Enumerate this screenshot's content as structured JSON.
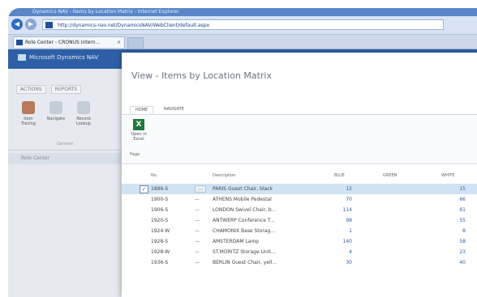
{
  "browser": {
    "title": "Dynamics NAV - Items by Location Matrix - Internet Explorer",
    "url": "http://dynamics-nav.net/DynamicsNAV/WebClient/default.aspx",
    "tab_label": "Role Center - CRONUS Intern...",
    "tab_close": "×",
    "back_glyph": "◀",
    "forward_glyph": "▶"
  },
  "app": {
    "brand": "Microsoft Dynamics NAV"
  },
  "left_pane": {
    "tabs": [
      "ACTIONS",
      "REPORTS"
    ],
    "actions": [
      {
        "label": "Item Tracing",
        "icon": "item-tracing-icon"
      },
      {
        "label": "Navigate",
        "icon": "navigate-icon"
      },
      {
        "label": "Record Lookup",
        "icon": "record-lookup-icon"
      }
    ],
    "group_label": "General",
    "nav_item": "Role Center"
  },
  "page": {
    "title": "View - Items by Location Matrix",
    "ribbon_tabs": [
      "HOME",
      "NAVIGATE"
    ],
    "ribbon_button": "Open in Excel",
    "ribbon_group": "Page",
    "excel_glyph": "X"
  },
  "table": {
    "headers": [
      "No.",
      "Description",
      "BLUE",
      "GREEN",
      "WHITE"
    ],
    "rows": [
      {
        "no": "1896-S",
        "dash": "...",
        "desc": "PARIS Guest Chair, black",
        "ab": "12",
        "mid": "",
        "west": "15",
        "selected": true
      },
      {
        "no": "1900-S",
        "dash": "—",
        "desc": "ATHENS Mobile Pedestal",
        "ab": "70",
        "mid": "",
        "west": "66",
        "selected": false
      },
      {
        "no": "1906-S",
        "dash": "—",
        "desc": "LONDON Swivel Chair, b...",
        "ab": "114",
        "mid": "",
        "west": "61",
        "selected": false
      },
      {
        "no": "1920-S",
        "dash": "—",
        "desc": "ANTWERP Conference T...",
        "ab": "98",
        "mid": "",
        "west": "55",
        "selected": false
      },
      {
        "no": "1924-W",
        "dash": "—",
        "desc": "CHAMONIX Base Storag...",
        "ab": "1",
        "mid": "",
        "west": "8",
        "selected": false
      },
      {
        "no": "1928-S",
        "dash": "—",
        "desc": "AMSTERDAM Lamp",
        "ab": "140",
        "mid": "",
        "west": "58",
        "selected": false
      },
      {
        "no": "1928-W",
        "dash": "—",
        "desc": "ST.MORITZ Storage Unit...",
        "ab": "4",
        "mid": "",
        "west": "23",
        "selected": false
      },
      {
        "no": "1936-S",
        "dash": "—",
        "desc": "BERLIN Guest Chair, yell...",
        "ab": "30",
        "mid": "",
        "west": "40",
        "selected": false
      }
    ]
  }
}
